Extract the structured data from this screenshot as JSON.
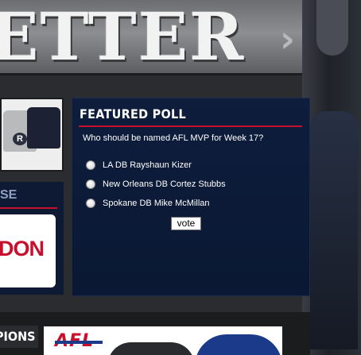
{
  "banner": {
    "word": "ETTER",
    "arrow_icon": "chevron-right-icon"
  },
  "merch": {
    "shirt_logo": "R"
  },
  "promo": {
    "heading": "SE",
    "card_text": "DON"
  },
  "poll": {
    "title": "FEATURED POLL",
    "question": "Who should be named AFL MVP for Week 17?",
    "options": [
      {
        "label": "LA DB Rayshaun Kizer"
      },
      {
        "label": "New Orleans DB Cortez Stubbs"
      },
      {
        "label": "Spokane DB Mike McMillan"
      }
    ],
    "vote_label": "vote"
  },
  "bottom": {
    "champions_tab": "PIONS",
    "afl_logo": "AFL"
  },
  "colors": {
    "accent_red": "#c8102e",
    "poll_bg": "#0e1d3c",
    "frame_dark": "#1b1c1e"
  }
}
